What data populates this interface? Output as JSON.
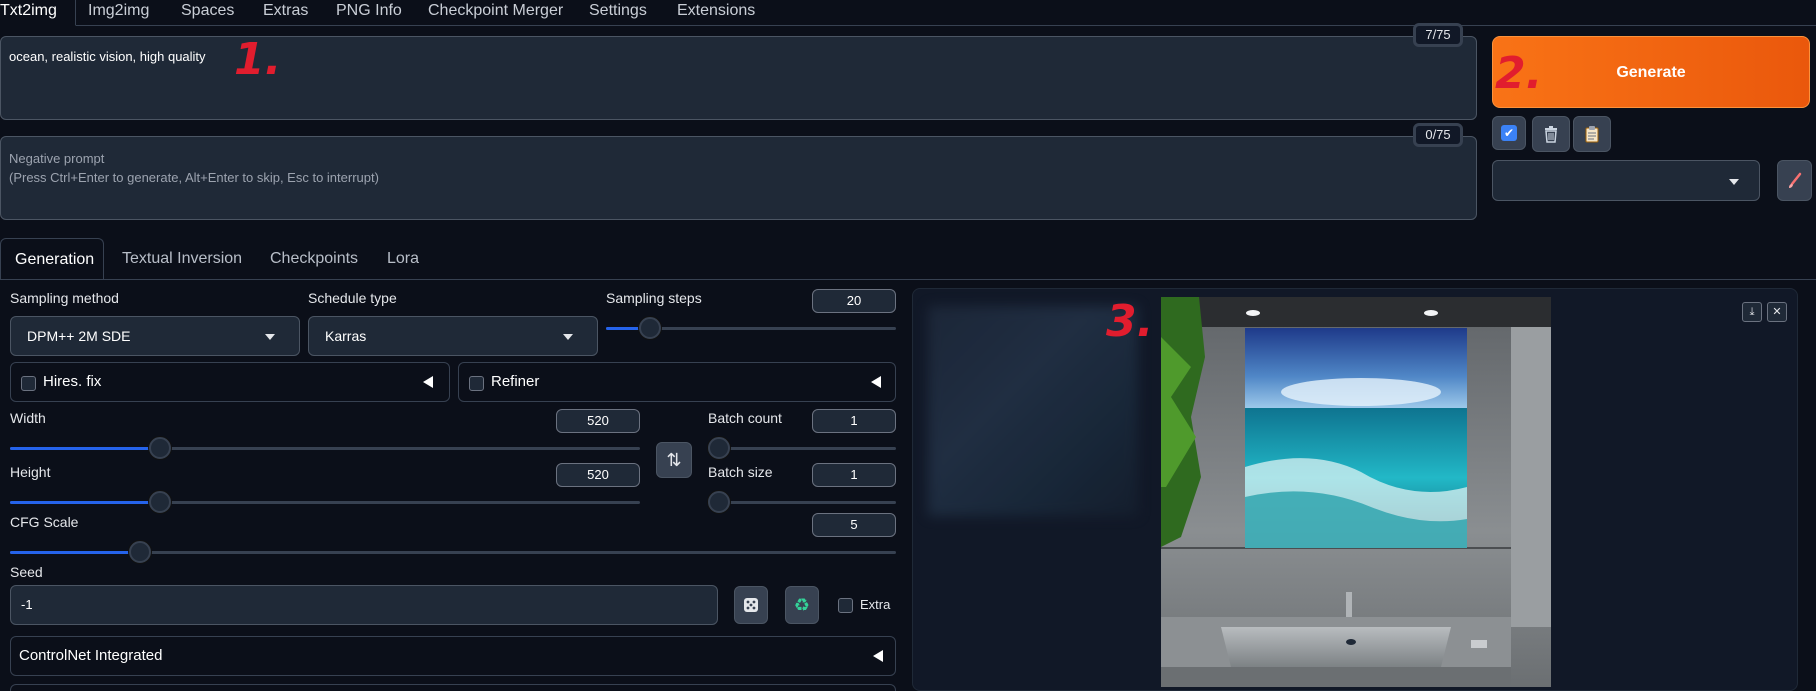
{
  "top_tabs": [
    "Txt2img",
    "Img2img",
    "Spaces",
    "Extras",
    "PNG Info",
    "Checkpoint Merger",
    "Settings",
    "Extensions"
  ],
  "prompt": {
    "text": "ocean, realistic vision, high quality",
    "counter": "7/75"
  },
  "negative_prompt": {
    "placeholder_line1": "Negative prompt",
    "placeholder_line2": "(Press Ctrl+Enter to generate, Alt+Enter to skip, Esc to interrupt)",
    "counter": "0/75"
  },
  "annotations": [
    "1.",
    "2.",
    "3."
  ],
  "generate_label": "Generate",
  "tool_icons": [
    "checkbox-icon",
    "trash-icon",
    "clipboard-icon",
    "brush-icon"
  ],
  "gen_tabs": [
    "Generation",
    "Textual Inversion",
    "Checkpoints",
    "Lora"
  ],
  "sampling": {
    "method_label": "Sampling method",
    "method_value": "DPM++ 2M SDE",
    "schedule_label": "Schedule type",
    "schedule_value": "Karras",
    "steps_label": "Sampling steps",
    "steps_value": "20"
  },
  "hires_label": "Hires. fix",
  "refiner_label": "Refiner",
  "width": {
    "label": "Width",
    "value": "520"
  },
  "height": {
    "label": "Height",
    "value": "520"
  },
  "batch_count": {
    "label": "Batch count",
    "value": "1"
  },
  "batch_size": {
    "label": "Batch size",
    "value": "1"
  },
  "cfg": {
    "label": "CFG Scale",
    "value": "5"
  },
  "seed": {
    "label": "Seed",
    "value": "-1"
  },
  "extra_label": "Extra",
  "controlnet_label": "ControlNet Integrated",
  "colors": {
    "accent": "#2563eb",
    "generate": "#f97316",
    "background": "#0b0f19",
    "annotation": "#e11d2e"
  }
}
